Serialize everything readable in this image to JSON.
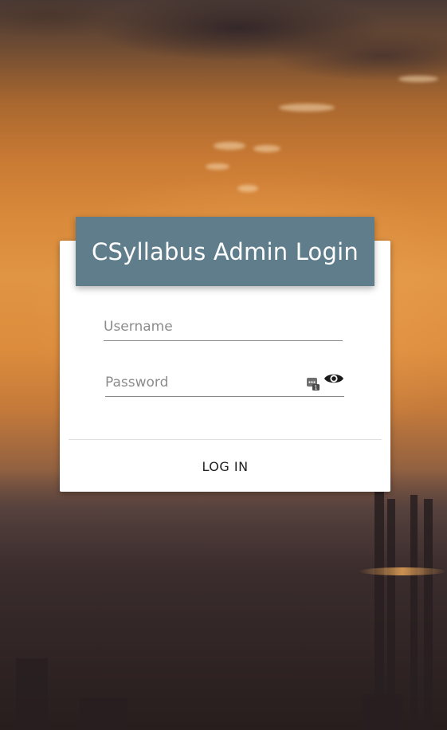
{
  "login": {
    "title": "CSyllabus Admin Login",
    "username_placeholder": "Username",
    "username_value": "",
    "password_placeholder": "Password",
    "password_value": "",
    "submit_label": "LOG IN"
  },
  "icons": {
    "password_manager": "password-manager-icon",
    "reveal_password": "eye-icon"
  },
  "colors": {
    "header_bg": "#607d8b",
    "header_text": "#ffffff",
    "card_bg": "#ffffff"
  }
}
